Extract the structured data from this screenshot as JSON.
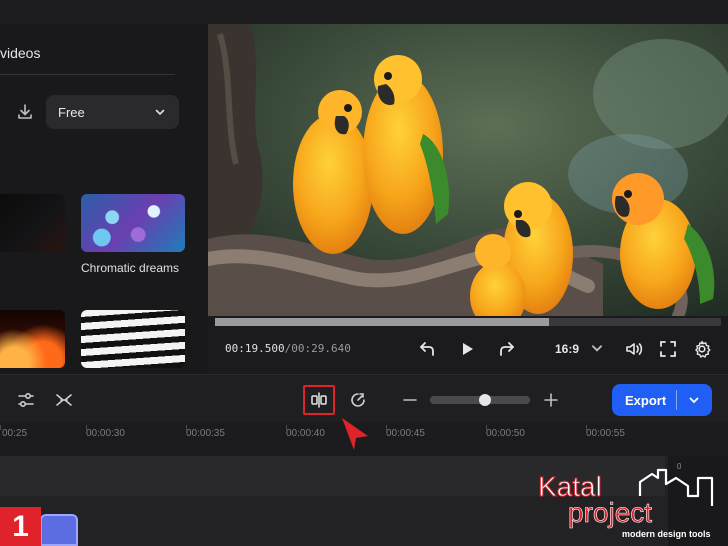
{
  "left_panel": {
    "title": "videos",
    "license_filter": {
      "value": "Free"
    },
    "thumbnails": [
      {
        "label": ""
      },
      {
        "label": "Chromatic dreams"
      },
      {
        "label": ""
      },
      {
        "label": ""
      }
    ]
  },
  "player": {
    "progress": 0.66,
    "time_current": "00:19.500",
    "time_separator": "/",
    "time_total": "00:29.640",
    "aspect_ratio": "16:9"
  },
  "toolbar": {
    "export_label": "Export",
    "zoom_level": 0.55
  },
  "ruler": {
    "ticks": [
      "00:25",
      "00:00:30",
      "00:00:35",
      "00:00:40",
      "00:00:45",
      "00:00:50",
      "00:00:55"
    ]
  },
  "meter": {
    "top_label": "0"
  },
  "annotation": {
    "step": "1"
  },
  "logo": {
    "line1": "Katal",
    "line2": "project",
    "tagline": "modern design tools"
  },
  "colors": {
    "accent": "#1f5ff5",
    "highlight": "#e0222a"
  }
}
